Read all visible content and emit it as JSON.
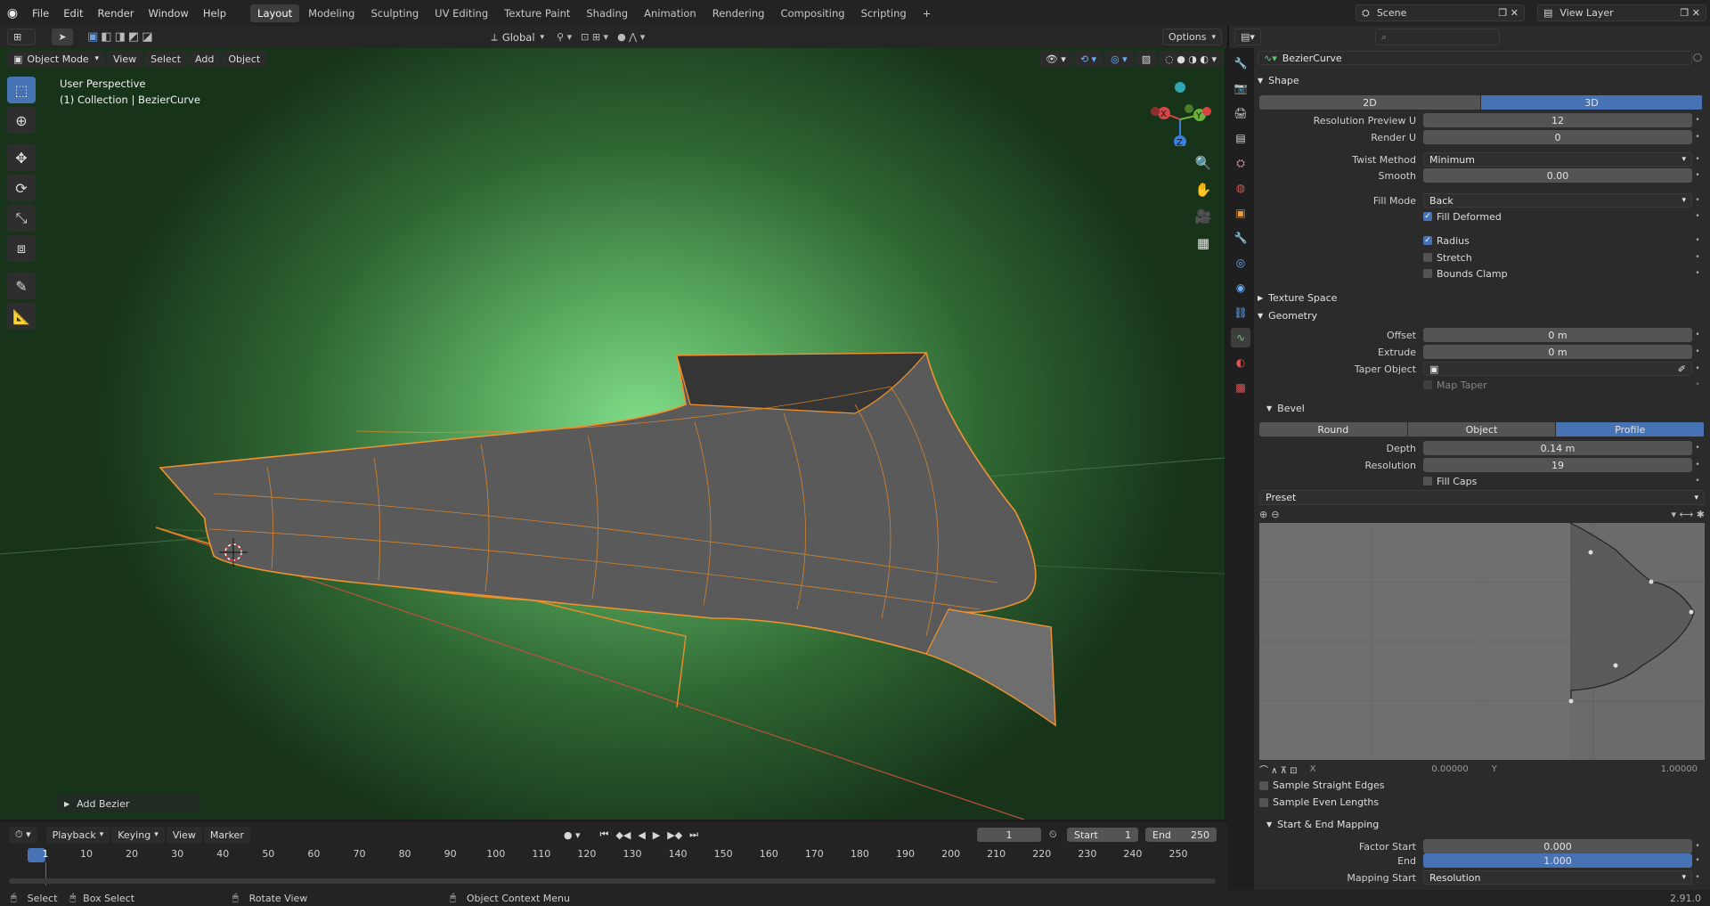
{
  "topbar": {
    "menus": [
      "File",
      "Edit",
      "Render",
      "Window",
      "Help"
    ],
    "workspaces": [
      "Layout",
      "Modeling",
      "Sculpting",
      "UV Editing",
      "Texture Paint",
      "Shading",
      "Animation",
      "Rendering",
      "Compositing",
      "Scripting"
    ],
    "active_workspace": "Layout",
    "add_tab": "+",
    "scene": "Scene",
    "view_layer": "View Layer"
  },
  "header": {
    "transform_orientation": "Global",
    "options": "Options"
  },
  "viewport_header": {
    "mode": "Object Mode",
    "menus": [
      "View",
      "Select",
      "Add",
      "Object"
    ]
  },
  "viewport": {
    "perspective": "User Perspective",
    "collection": "(1) Collection | BezierCurve",
    "gizmo": {
      "x": "X",
      "y": "Y",
      "z": "Z"
    },
    "operator_panel": "Add Bezier"
  },
  "props": {
    "object_name": "BezierCurve",
    "search_placeholder": "",
    "shape": {
      "title": "Shape",
      "dim2d": "2D",
      "dim3d": "3D",
      "active_dim": "3D",
      "resolution_preview_u": {
        "label": "Resolution Preview U",
        "value": "12"
      },
      "render_u": {
        "label": "Render U",
        "value": "0"
      },
      "twist_method": {
        "label": "Twist Method",
        "value": "Minimum"
      },
      "smooth": {
        "label": "Smooth",
        "value": "0.00"
      },
      "fill_mode": {
        "label": "Fill Mode",
        "value": "Back"
      },
      "fill_deformed": {
        "label": "Fill Deformed",
        "checked": true
      },
      "radius": {
        "label": "Radius",
        "checked": true
      },
      "stretch": {
        "label": "Stretch",
        "checked": false
      },
      "bounds_clamp": {
        "label": "Bounds Clamp",
        "checked": false
      }
    },
    "texture_space": {
      "title": "Texture Space"
    },
    "geometry": {
      "title": "Geometry",
      "offset": {
        "label": "Offset",
        "value": "0 m"
      },
      "extrude": {
        "label": "Extrude",
        "value": "0 m"
      },
      "taper_object": {
        "label": "Taper Object",
        "value": ""
      },
      "map_taper": {
        "label": "Map Taper",
        "checked": false
      }
    },
    "bevel": {
      "title": "Bevel",
      "modes": [
        "Round",
        "Object",
        "Profile"
      ],
      "active_mode": "Profile",
      "depth": {
        "label": "Depth",
        "value": "0.14 m"
      },
      "resolution": {
        "label": "Resolution",
        "value": "19"
      },
      "fill_caps": {
        "label": "Fill Caps",
        "checked": false
      },
      "preset": "Preset",
      "curve_x_label": "X",
      "curve_x": "0.00000",
      "curve_y_label": "Y",
      "curve_y": "1.00000",
      "sample_straight": {
        "label": "Sample Straight Edges",
        "checked": false
      },
      "sample_even": {
        "label": "Sample Even Lengths",
        "checked": false
      }
    },
    "mapping": {
      "title": "Start & End Mapping",
      "factor_start": {
        "label": "Factor Start",
        "value": "0.000"
      },
      "end": {
        "label": "End",
        "value": "1.000"
      },
      "mapping_start": {
        "label": "Mapping Start",
        "value": "Resolution"
      }
    }
  },
  "timeline": {
    "menus": [
      "Playback",
      "Keying",
      "View",
      "Marker"
    ],
    "current_frame": "1",
    "start_label": "Start",
    "start": "1",
    "end_label": "End",
    "end": "250",
    "ticks": [
      "1",
      "10",
      "20",
      "30",
      "40",
      "50",
      "60",
      "70",
      "80",
      "90",
      "100",
      "110",
      "120",
      "130",
      "140",
      "150",
      "160",
      "170",
      "180",
      "190",
      "200",
      "210",
      "220",
      "230",
      "240",
      "250"
    ]
  },
  "status": {
    "select": "Select",
    "box_select": "Box Select",
    "rotate_view": "Rotate View",
    "context_menu": "Object Context Menu",
    "version": "2.91.0"
  },
  "colors": {
    "accent": "#4772b3",
    "selection": "#f0932f",
    "background": "#232323"
  }
}
